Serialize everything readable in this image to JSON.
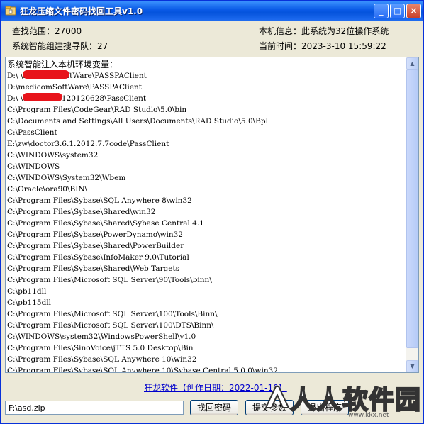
{
  "window": {
    "title": "狂龙压缩文件密码找回工具v1.0"
  },
  "titlebar_buttons": {
    "minimize": "_",
    "maximize": "□",
    "close": "×"
  },
  "info": {
    "search_range": "查找范围：27000",
    "system_info": "本机信息：此系统为32位操作系统",
    "team": "系统智能组建搜寻队：27",
    "current_time": "当前时间：2023-3-10  15:59:22"
  },
  "log": {
    "header": "系统智能注入本机环境变量：",
    "lines": [
      "D:\\        \\medicomSoftWare\\PASSPAClient",
      "D:\\medicomSoftWare\\PASSPAClient",
      "D:\\           \\doctor3.6.120120628\\PassClient",
      "C:\\Program Files\\CodeGear\\RAD Studio\\5.0\\bin",
      "C:\\Documents and Settings\\All Users\\Documents\\RAD Studio\\5.0\\Bpl",
      "C:\\PassClient",
      "E:\\zw\\doctor3.6.1.2012.7.7code\\PassClient",
      "C:\\WINDOWS\\system32",
      "C:\\WINDOWS",
      "C:\\WINDOWS\\System32\\Wbem",
      "C:\\Oracle\\ora90\\BIN\\",
      "C:\\Program Files\\Sybase\\SQL Anywhere 8\\win32",
      "C:\\Program Files\\Sybase\\Shared\\win32",
      "C:\\Program Files\\Sybase\\Shared\\Sybase Central 4.1",
      "C:\\Program Files\\Sybase\\PowerDynamo\\win32",
      "C:\\Program Files\\Sybase\\Shared\\PowerBuilder",
      "C:\\Program Files\\Sybase\\InfoMaker 9.0\\Tutorial",
      "C:\\Program Files\\Sybase\\Shared\\Web Targets",
      "C:\\Program Files\\Microsoft SQL Server\\90\\Tools\\binn\\",
      "C:\\pb11dll",
      "C:\\pb115dll",
      "C:\\Program Files\\Microsoft SQL Server\\100\\Tools\\Binn\\",
      "C:\\Program Files\\Microsoft SQL Server\\100\\DTS\\Binn\\",
      "C:\\WINDOWS\\system32\\WindowsPowerShell\\v1.0",
      "C:\\Program Files\\SinoVoice\\jTTS 5.0 Desktop\\Bin",
      "C:\\Program Files\\Sybase\\SQL Anywhere 10\\win32",
      "C:\\Program Files\\Sybase\\SQL Anywhere 10\\Sybase Central 5.0.0\\win32"
    ]
  },
  "footer": {
    "link": "狂龙软件【创作日期：2022-01-10】",
    "path_value": "F:\\asd.zip",
    "recover_button": "找回密码",
    "button2": "提交参数",
    "button3": "退出程序"
  },
  "watermark": {
    "text": "人人软件园",
    "url": "www.kkx.net"
  }
}
